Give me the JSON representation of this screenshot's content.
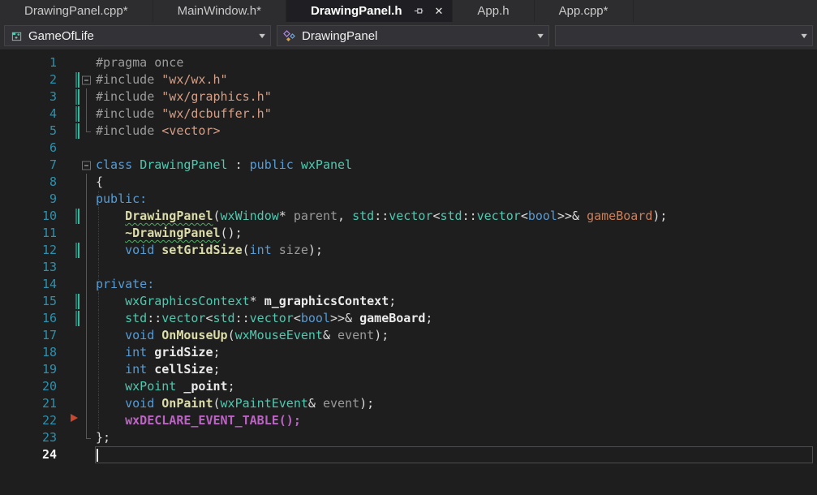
{
  "tabs": [
    {
      "label": "DrawingPanel.cpp*",
      "active": false
    },
    {
      "label": "MainWindow.h*",
      "active": false
    },
    {
      "label": "DrawingPanel.h",
      "active": true,
      "pinned": true,
      "closable": true
    },
    {
      "label": "App.h",
      "active": false
    },
    {
      "label": "App.cpp*",
      "active": false
    }
  ],
  "navbar": {
    "project": "GameOfLife",
    "type": "DrawingPanel",
    "member": ""
  },
  "icons": {
    "close_glyph": "✕",
    "dropdown_glyph": "▼"
  },
  "colors": {
    "editor_bg": "#1E1E1E",
    "chrome_bg": "#2D2D30",
    "combo_bg": "#333337",
    "keyword": "#569CD6",
    "type": "#4EC9B0",
    "function": "#DCDCAA",
    "string": "#D69D85",
    "preprocessor": "#9B9B9B",
    "macro": "#BD63C5",
    "parameter": "#9A9A9A",
    "line_number": "#2B91AF",
    "change_bar": "#38B89A",
    "margin_marker": "#C7472F"
  },
  "editor": {
    "language": "C++",
    "lines": [
      {
        "n": 1,
        "tokens": [
          {
            "t": "#pragma once",
            "c": "pp"
          }
        ]
      },
      {
        "n": 2,
        "change": true,
        "fold": "box",
        "tokens": [
          {
            "t": "#include ",
            "c": "pp"
          },
          {
            "t": "\"wx/wx.h\"",
            "c": "str"
          }
        ]
      },
      {
        "n": 3,
        "change": true,
        "fold": "mid",
        "tokens": [
          {
            "t": "#include ",
            "c": "pp"
          },
          {
            "t": "\"wx/graphics.h\"",
            "c": "str"
          }
        ]
      },
      {
        "n": 4,
        "change": true,
        "fold": "mid",
        "tokens": [
          {
            "t": "#include ",
            "c": "pp"
          },
          {
            "t": "\"wx/dcbuffer.h\"",
            "c": "str"
          }
        ]
      },
      {
        "n": 5,
        "change": true,
        "fold": "end",
        "tokens": [
          {
            "t": "#include ",
            "c": "pp"
          },
          {
            "t": "<vector>",
            "c": "str"
          }
        ]
      },
      {
        "n": 6,
        "tokens": []
      },
      {
        "n": 7,
        "fold": "box",
        "tokens": [
          {
            "t": "class ",
            "c": "kw"
          },
          {
            "t": "DrawingPanel",
            "c": "ty"
          },
          {
            "t": " : ",
            "c": "op"
          },
          {
            "t": "public ",
            "c": "kw"
          },
          {
            "t": "wxPanel",
            "c": "ty"
          }
        ]
      },
      {
        "n": 8,
        "fold": "mid",
        "tokens": [
          {
            "t": "{",
            "c": "op"
          }
        ]
      },
      {
        "n": 9,
        "fold": "mid",
        "guide": true,
        "tokens": [
          {
            "t": "public:",
            "c": "kw"
          }
        ]
      },
      {
        "n": 10,
        "change": true,
        "fold": "mid",
        "guide": true,
        "tokens": [
          {
            "t": "    ",
            "c": "op"
          },
          {
            "t": "DrawingPanel",
            "c": "fn sq"
          },
          {
            "t": "(",
            "c": "op"
          },
          {
            "t": "wxWindow",
            "c": "ty"
          },
          {
            "t": "* ",
            "c": "op"
          },
          {
            "t": "parent",
            "c": "param"
          },
          {
            "t": ", ",
            "c": "op"
          },
          {
            "t": "std",
            "c": "ty"
          },
          {
            "t": "::",
            "c": "op"
          },
          {
            "t": "vector",
            "c": "ty"
          },
          {
            "t": "<",
            "c": "op"
          },
          {
            "t": "std",
            "c": "ty"
          },
          {
            "t": "::",
            "c": "op"
          },
          {
            "t": "vector",
            "c": "ty"
          },
          {
            "t": "<",
            "c": "op"
          },
          {
            "t": "bool",
            "c": "kw"
          },
          {
            "t": ">>& ",
            "c": "op"
          },
          {
            "t": "gameBoard",
            "c": "pref"
          },
          {
            "t": ");",
            "c": "op"
          }
        ]
      },
      {
        "n": 11,
        "fold": "mid",
        "guide": true,
        "tokens": [
          {
            "t": "    ",
            "c": "op"
          },
          {
            "t": "~DrawingPanel",
            "c": "fn sq"
          },
          {
            "t": "();",
            "c": "op"
          }
        ]
      },
      {
        "n": 12,
        "change": true,
        "fold": "mid",
        "guide": true,
        "tokens": [
          {
            "t": "    ",
            "c": "op"
          },
          {
            "t": "void ",
            "c": "kw"
          },
          {
            "t": "setGridSize",
            "c": "fn"
          },
          {
            "t": "(",
            "c": "op"
          },
          {
            "t": "int ",
            "c": "kw"
          },
          {
            "t": "size",
            "c": "param"
          },
          {
            "t": ");",
            "c": "op"
          }
        ]
      },
      {
        "n": 13,
        "fold": "mid",
        "guide": true,
        "tokens": []
      },
      {
        "n": 14,
        "fold": "mid",
        "guide": true,
        "tokens": [
          {
            "t": "private:",
            "c": "kw"
          }
        ]
      },
      {
        "n": 15,
        "change": true,
        "fold": "mid",
        "guide": true,
        "tokens": [
          {
            "t": "    ",
            "c": "op"
          },
          {
            "t": "wxGraphicsContext",
            "c": "ty"
          },
          {
            "t": "* ",
            "c": "op"
          },
          {
            "t": "m_graphicsContext",
            "c": "field"
          },
          {
            "t": ";",
            "c": "op"
          }
        ]
      },
      {
        "n": 16,
        "change": true,
        "fold": "mid",
        "guide": true,
        "tokens": [
          {
            "t": "    ",
            "c": "op"
          },
          {
            "t": "std",
            "c": "ty"
          },
          {
            "t": "::",
            "c": "op"
          },
          {
            "t": "vector",
            "c": "ty"
          },
          {
            "t": "<",
            "c": "op"
          },
          {
            "t": "std",
            "c": "ty"
          },
          {
            "t": "::",
            "c": "op"
          },
          {
            "t": "vector",
            "c": "ty"
          },
          {
            "t": "<",
            "c": "op"
          },
          {
            "t": "bool",
            "c": "kw"
          },
          {
            "t": ">>& ",
            "c": "op"
          },
          {
            "t": "gameBoard",
            "c": "field"
          },
          {
            "t": ";",
            "c": "op"
          }
        ]
      },
      {
        "n": 17,
        "fold": "mid",
        "guide": true,
        "tokens": [
          {
            "t": "    ",
            "c": "op"
          },
          {
            "t": "void ",
            "c": "kw"
          },
          {
            "t": "OnMouseUp",
            "c": "fn"
          },
          {
            "t": "(",
            "c": "op"
          },
          {
            "t": "wxMouseEvent",
            "c": "ty"
          },
          {
            "t": "& ",
            "c": "op"
          },
          {
            "t": "event",
            "c": "param"
          },
          {
            "t": ");",
            "c": "op"
          }
        ]
      },
      {
        "n": 18,
        "fold": "mid",
        "guide": true,
        "tokens": [
          {
            "t": "    ",
            "c": "op"
          },
          {
            "t": "int ",
            "c": "kw"
          },
          {
            "t": "gridSize",
            "c": "field"
          },
          {
            "t": ";",
            "c": "op"
          }
        ]
      },
      {
        "n": 19,
        "fold": "mid",
        "guide": true,
        "tokens": [
          {
            "t": "    ",
            "c": "op"
          },
          {
            "t": "int ",
            "c": "kw"
          },
          {
            "t": "cellSize",
            "c": "field"
          },
          {
            "t": ";",
            "c": "op"
          }
        ]
      },
      {
        "n": 20,
        "fold": "mid",
        "guide": true,
        "tokens": [
          {
            "t": "    ",
            "c": "op"
          },
          {
            "t": "wxPoint",
            "c": "ty"
          },
          {
            "t": " ",
            "c": "op"
          },
          {
            "t": "_point",
            "c": "field"
          },
          {
            "t": ";",
            "c": "op"
          }
        ]
      },
      {
        "n": 21,
        "fold": "mid",
        "guide": true,
        "tokens": [
          {
            "t": "    ",
            "c": "op"
          },
          {
            "t": "void ",
            "c": "kw"
          },
          {
            "t": "OnPaint",
            "c": "fn"
          },
          {
            "t": "(",
            "c": "op"
          },
          {
            "t": "wxPaintEvent",
            "c": "ty"
          },
          {
            "t": "& ",
            "c": "op"
          },
          {
            "t": "event",
            "c": "param"
          },
          {
            "t": ");",
            "c": "op"
          }
        ]
      },
      {
        "n": 22,
        "fold": "mid",
        "guide": true,
        "marker": true,
        "tokens": [
          {
            "t": "    ",
            "c": "op"
          },
          {
            "t": "wxDECLARE_EVENT_TABLE();",
            "c": "macro"
          }
        ]
      },
      {
        "n": 23,
        "fold": "end",
        "tokens": [
          {
            "t": "};",
            "c": "op"
          }
        ]
      },
      {
        "n": 24,
        "current": true,
        "tokens": []
      }
    ]
  }
}
